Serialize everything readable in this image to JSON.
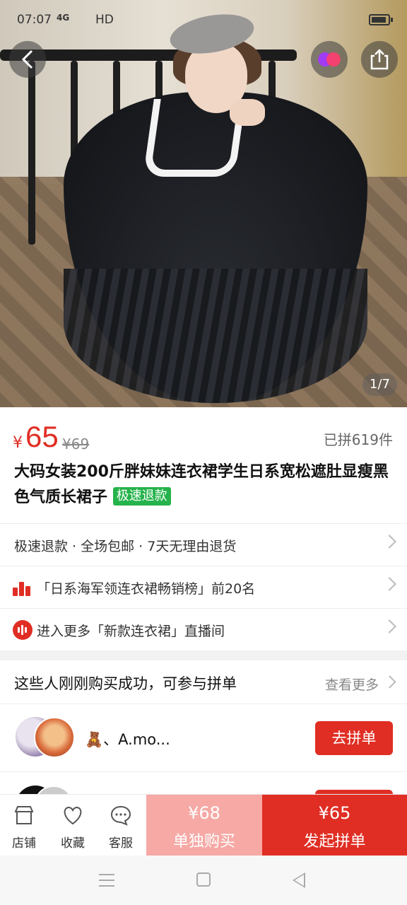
{
  "status_bar": {
    "time": "07:07",
    "network": "4G",
    "hd": "HD"
  },
  "gallery": {
    "counter": "1/7"
  },
  "price": {
    "currency": "¥",
    "current": "65",
    "original": "¥69",
    "sold": "已拼619件"
  },
  "product": {
    "title": "大码女装200斤胖妹妹连衣裙学生日系宽松遮肚显瘦黑色气质长裙子",
    "tag": "极速退款"
  },
  "services": {
    "text": "极速退款 · 全场包邮 · 7天无理由退货"
  },
  "ranking": {
    "text": "「日系海军领连衣裙畅销榜」前20名"
  },
  "live": {
    "text": "进入更多「新款连衣裙」直播间"
  },
  "group_buy": {
    "heading": "这些人刚刚购买成功，可参与拼单",
    "more": "查看更多",
    "entries": [
      {
        "name": "🧸、A.mo...",
        "button": "去拼单"
      }
    ]
  },
  "bottom_bar": {
    "store": "店铺",
    "favorite": "收藏",
    "service": "客服",
    "solo_price": "¥68",
    "solo_label": "单独购买",
    "group_price": "¥65",
    "group_label": "发起拼单"
  },
  "colors": {
    "accent": "#e02e24",
    "solo_bg": "#f6a9a5",
    "refund_tag": "#25b34b"
  }
}
